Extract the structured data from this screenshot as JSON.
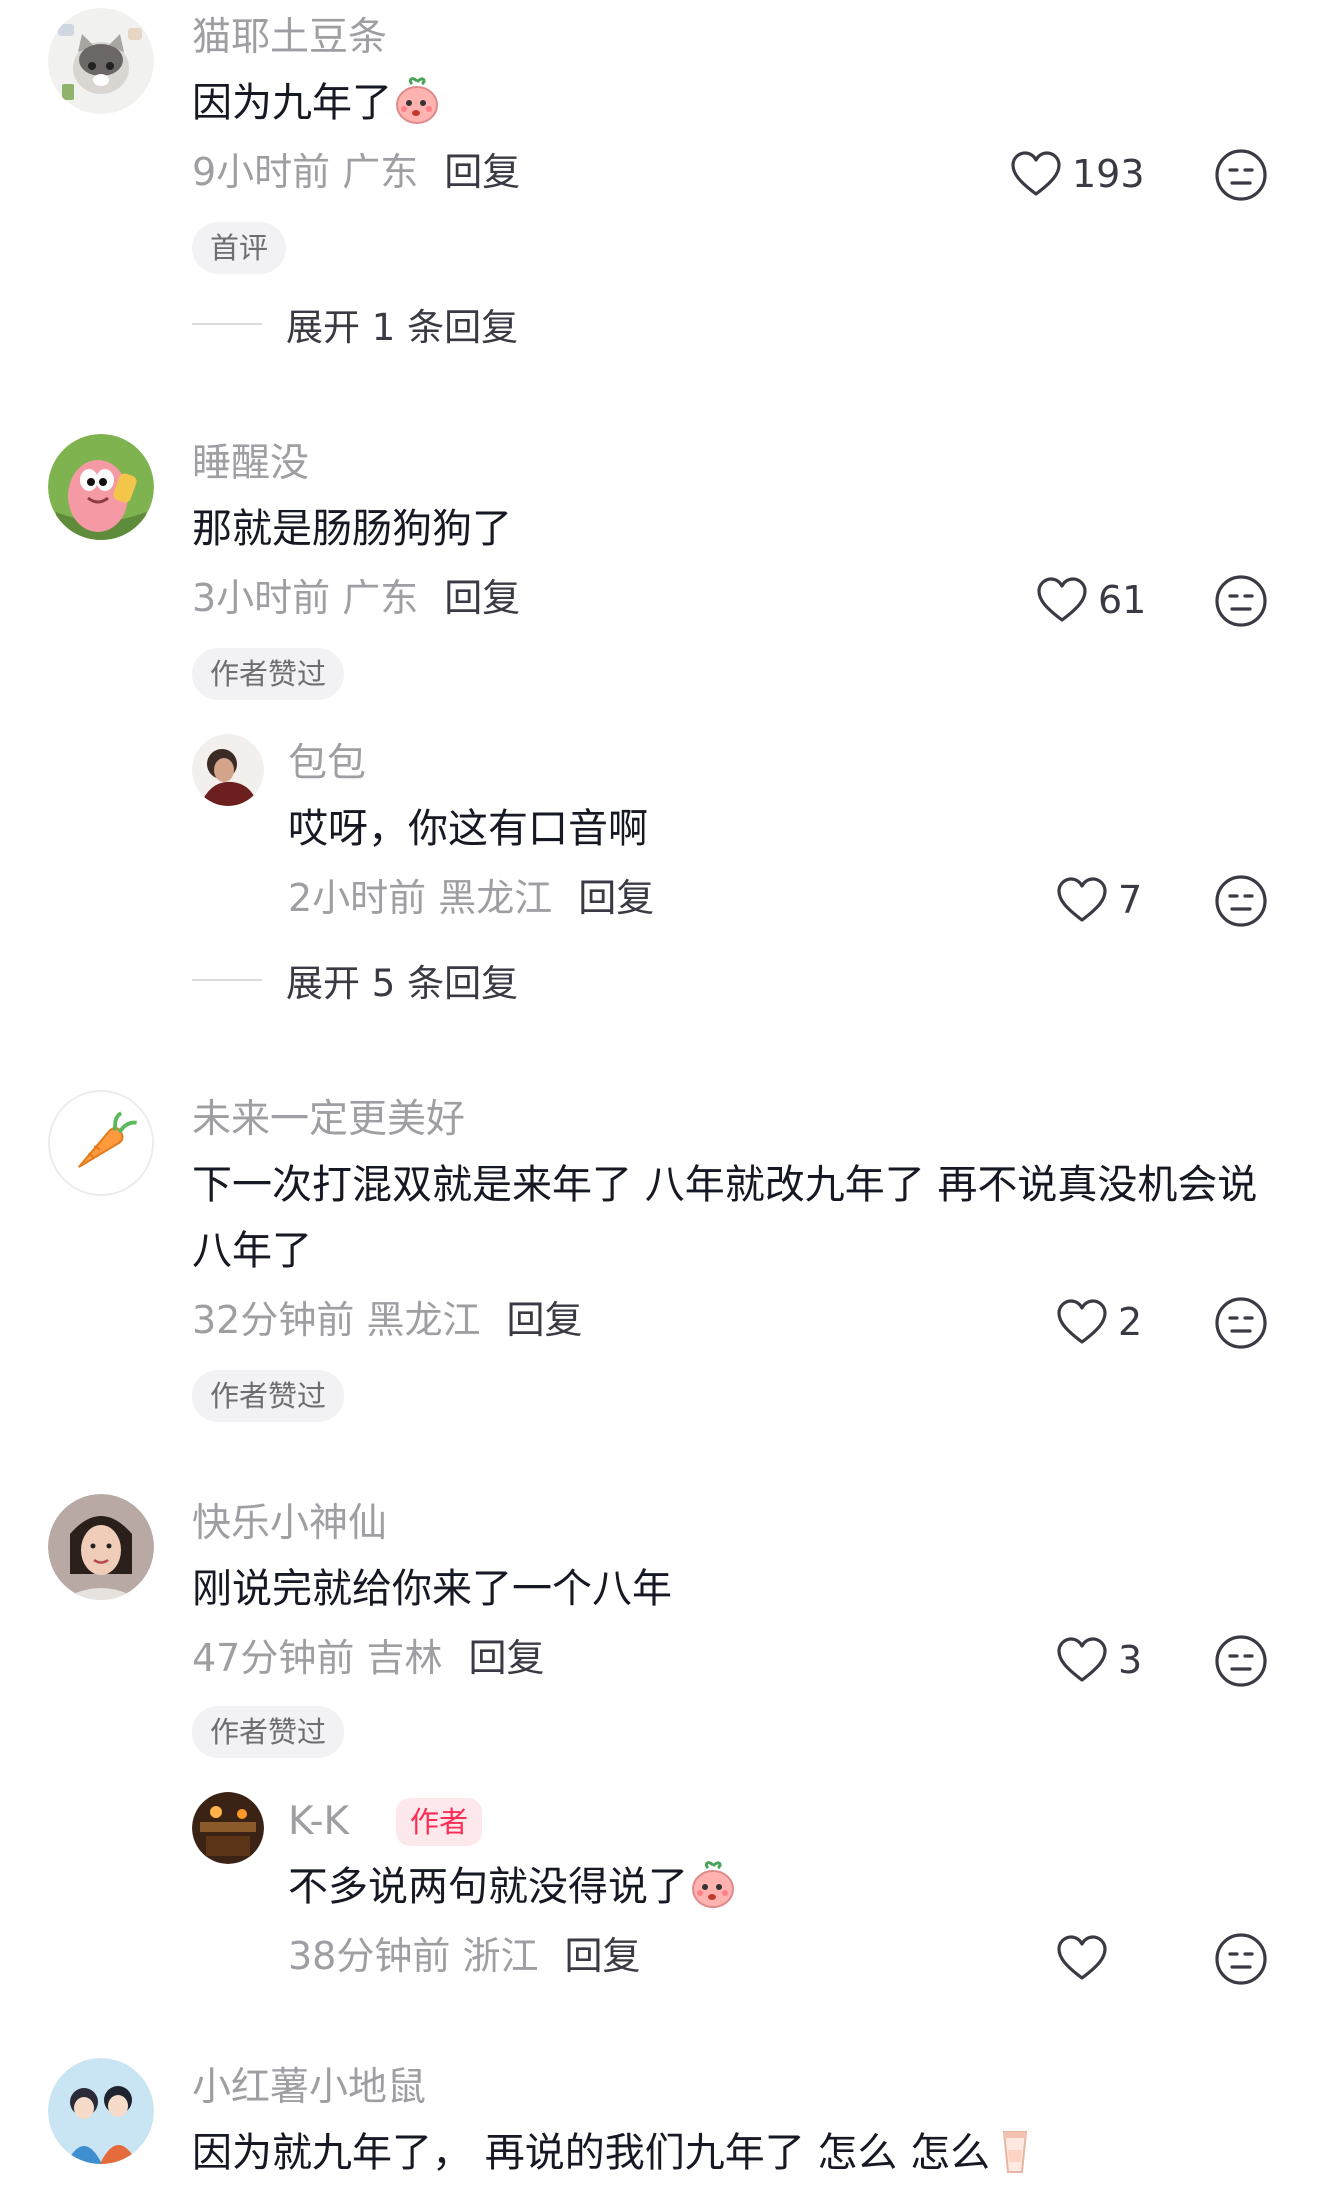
{
  "comments": [
    {
      "avatar_icon": "cat-avatar-icon",
      "username": "猫耶土豆条",
      "text": "因为九年了",
      "emoji_icon": "shy-peach-emoji-icon",
      "time": "9小时前",
      "location": "广东",
      "reply_label": "回复",
      "likes": "193",
      "badge": "首评",
      "expand_label": "展开 1 条回复"
    },
    {
      "avatar_icon": "patrick-star-avatar-icon",
      "username": "睡醒没",
      "text": "那就是肠肠狗狗了",
      "time": "3小时前",
      "location": "广东",
      "reply_label": "回复",
      "likes": "61",
      "badge": "作者赞过",
      "replies": [
        {
          "avatar_icon": "person-avatar-icon",
          "username": "包包",
          "text": "哎呀，你这有口音啊",
          "time": "2小时前",
          "location": "黑龙江",
          "reply_label": "回复",
          "likes": "7"
        }
      ],
      "expand_label": "展开 5 条回复"
    },
    {
      "avatar_icon": "carrot-avatar-icon",
      "username": "未来一定更美好",
      "text": "下一次打混双就是来年了 八年就改九年了 再不说真没机会说八年了",
      "time": "32分钟前",
      "location": "黑龙江",
      "reply_label": "回复",
      "likes": "2",
      "badge": "作者赞过"
    },
    {
      "avatar_icon": "woman-avatar-icon",
      "username": "快乐小神仙",
      "text": "刚说完就给你来了一个八年",
      "time": "47分钟前",
      "location": "吉林",
      "reply_label": "回复",
      "likes": "3",
      "badge": "作者赞过",
      "replies": [
        {
          "avatar_icon": "dark-room-avatar-icon",
          "username": "K-K",
          "author_tag": "作者",
          "text": "不多说两句就没得说了",
          "emoji_icon": "shy-peach-emoji-icon",
          "time": "38分钟前",
          "location": "浙江",
          "reply_label": "回复"
        }
      ]
    },
    {
      "avatar_icon": "anime-couple-avatar-icon",
      "username": "小红薯小地鼠",
      "text": "因为就九年了，  再说的我们九年了  怎么 怎么",
      "emoji_icon": "drink-cup-emoji-icon"
    }
  ],
  "icons": {
    "like": "heart-outline-icon",
    "dislike": "neutral-face-icon"
  },
  "colors": {
    "username": "#9e9ea3",
    "text": "#161823",
    "author_tag": "#fe2c55",
    "badge_bg": "#f2f2f4"
  }
}
